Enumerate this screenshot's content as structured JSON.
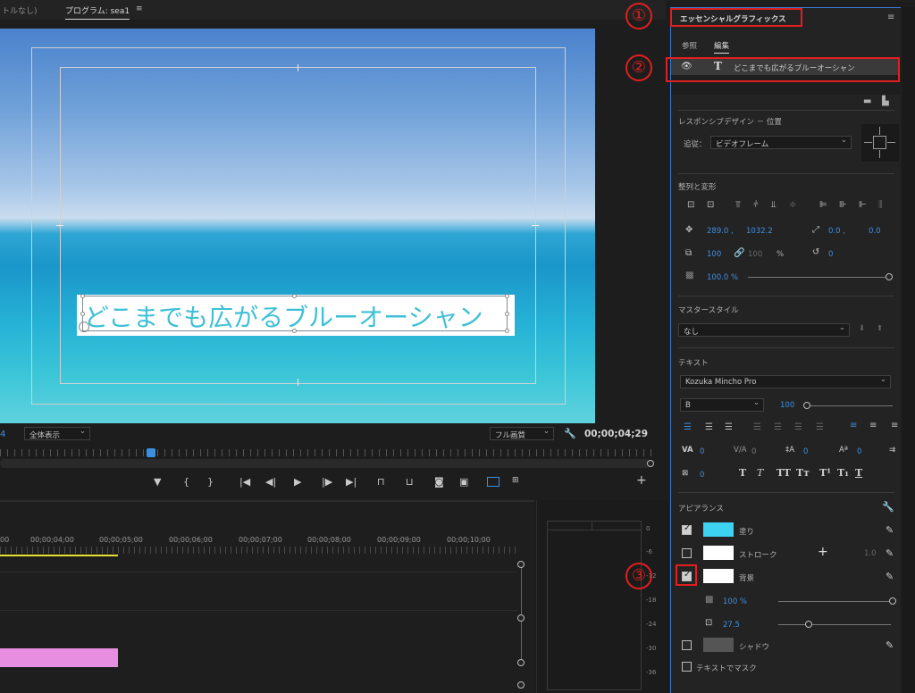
{
  "top_tabs": {
    "prev": "トルなし)",
    "program": "プログラム: sea1",
    "menu": "≡"
  },
  "monitor": {
    "caption": "どこまでも広がるブルーオーシャン",
    "timecode_left": "4",
    "zoom": "全体表示",
    "quality": "フル画質",
    "timecode": "00;00;04;29"
  },
  "controls": [
    "▼",
    "{",
    "}",
    "|◀",
    "◀|",
    "▶",
    "|▶",
    "▶|"
  ],
  "timeline": {
    "ticks": [
      "00",
      "00;00;04;00",
      "00;00;05;00",
      "00;00;06;00",
      "00;00;07;00",
      "00;00;08;00",
      "00;00;09;00",
      "00;00;10;00"
    ],
    "clip_color": "#e88ee0"
  },
  "meter": [
    "0",
    "-6",
    "-12",
    "-18",
    "-24",
    "-30",
    "-36"
  ],
  "panel": {
    "title": "エッセンシャルグラフィックス",
    "tabs": [
      "参照",
      "編集"
    ],
    "layer_name": "どこまでも広がるブルーオーシャン",
    "responsive_heading": "レスポンシブデザイン － 位置",
    "follow_label": "追従：",
    "follow_value": "ビデオフレーム",
    "align_heading": "整列と変形",
    "pos_x": "289.0 ,",
    "pos_y": "1032.2",
    "anchor_x": "0.0 ,",
    "anchor_y": "0.0",
    "scale": "100",
    "scale_dim": "100",
    "pct": "%",
    "rotation": "0",
    "opacity": "100.0 %",
    "master_heading": "マスタースタイル",
    "master_value": "なし",
    "text_heading": "テキスト",
    "font": "Kozuka Mincho Pro",
    "font_style": "B",
    "font_size": "100",
    "tracking": "0",
    "kerning": "0",
    "leading": "0",
    "baseline": "0",
    "tsume": "0",
    "appearance_heading": "アピアランス",
    "fill_label": "塗り",
    "fill_color": "#3ed2f2",
    "stroke_label": "ストローク",
    "stroke_value": "1.0",
    "bg_label": "背景",
    "bg_opacity": "100 %",
    "bg_size": "27.5",
    "shadow_label": "シャドウ",
    "mask_label": "テキストでマスク"
  },
  "annotations": [
    "①",
    "②",
    "③"
  ]
}
